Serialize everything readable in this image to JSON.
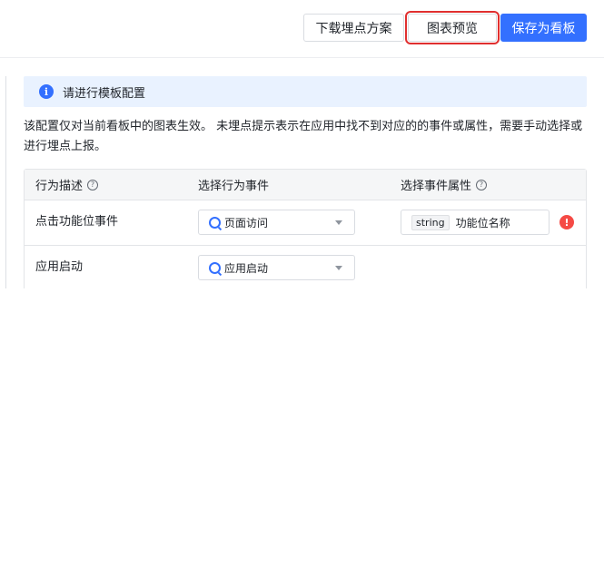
{
  "toolbar": {
    "download_label": "下载埋点方案",
    "preview_label": "图表预览",
    "save_label": "保存为看板"
  },
  "notice": {
    "icon": "info-icon",
    "text": "请进行模板配置"
  },
  "description": "该配置仅对当前看板中的图表生效。 未埋点提示表示在应用中找不到对应的的事件或属性，需要手动选择或进行埋点上报。",
  "table": {
    "headers": {
      "behavior": "行为描述",
      "event": "选择行为事件",
      "property": "选择事件属性"
    },
    "rows": [
      {
        "behavior": "点击功能位事件",
        "event": "页面访问",
        "property_type": "string",
        "property": "功能位名称",
        "warning": true
      },
      {
        "behavior": "应用启动",
        "event": "应用启动"
      }
    ]
  },
  "colors": {
    "primary": "#3370ff",
    "highlight": "#e02f2f",
    "notice_bg": "#e9f2ff",
    "warning": "#f54a45"
  }
}
